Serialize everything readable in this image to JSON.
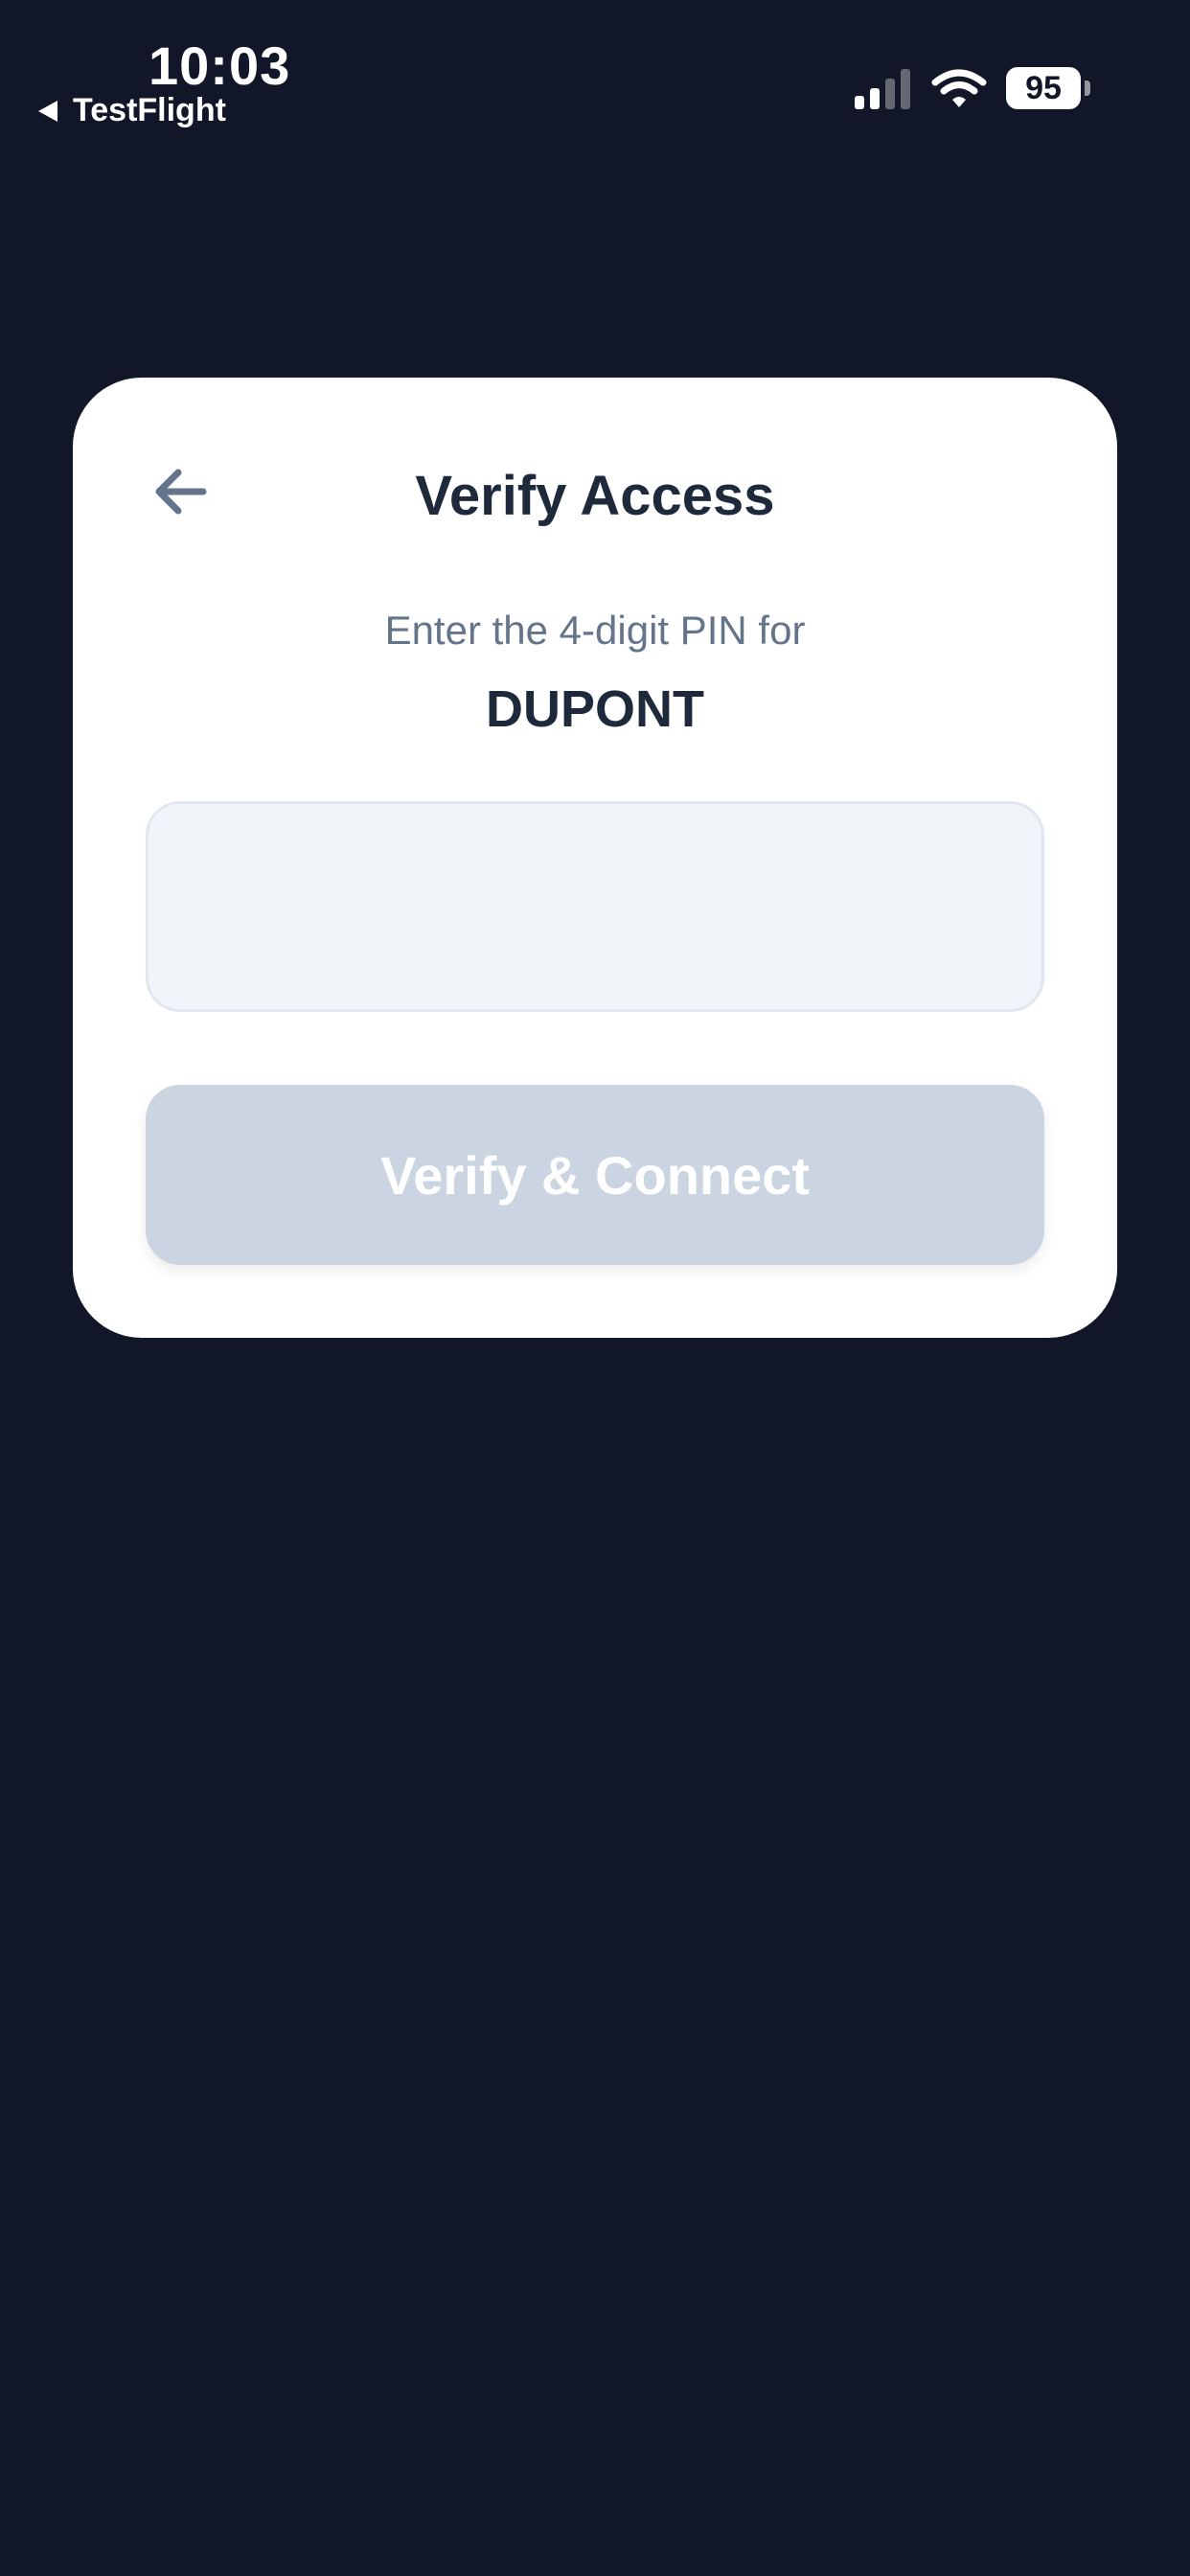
{
  "status_bar": {
    "time": "10:03",
    "back_app_label": "TestFlight",
    "battery_percent": "95",
    "signal_strength": 2,
    "icons": [
      "signal-icon",
      "wifi-icon",
      "battery-icon"
    ]
  },
  "dialog": {
    "title": "Verify Access",
    "subtitle": "Enter the 4-digit PIN for",
    "entity_name": "DUPONT",
    "pin_input": {
      "value": "",
      "placeholder": ""
    },
    "verify_button_label": "Verify & Connect",
    "back_icon": "arrow-left-icon"
  },
  "colors": {
    "background": "#111729",
    "card": "#ffffff",
    "title_text": "#1e293b",
    "subtitle_text": "#64748b",
    "input_background": "#f1f4f9",
    "input_border": "#e1e7ef",
    "button_disabled": "#cbd5e1",
    "button_text": "#ffffff"
  }
}
